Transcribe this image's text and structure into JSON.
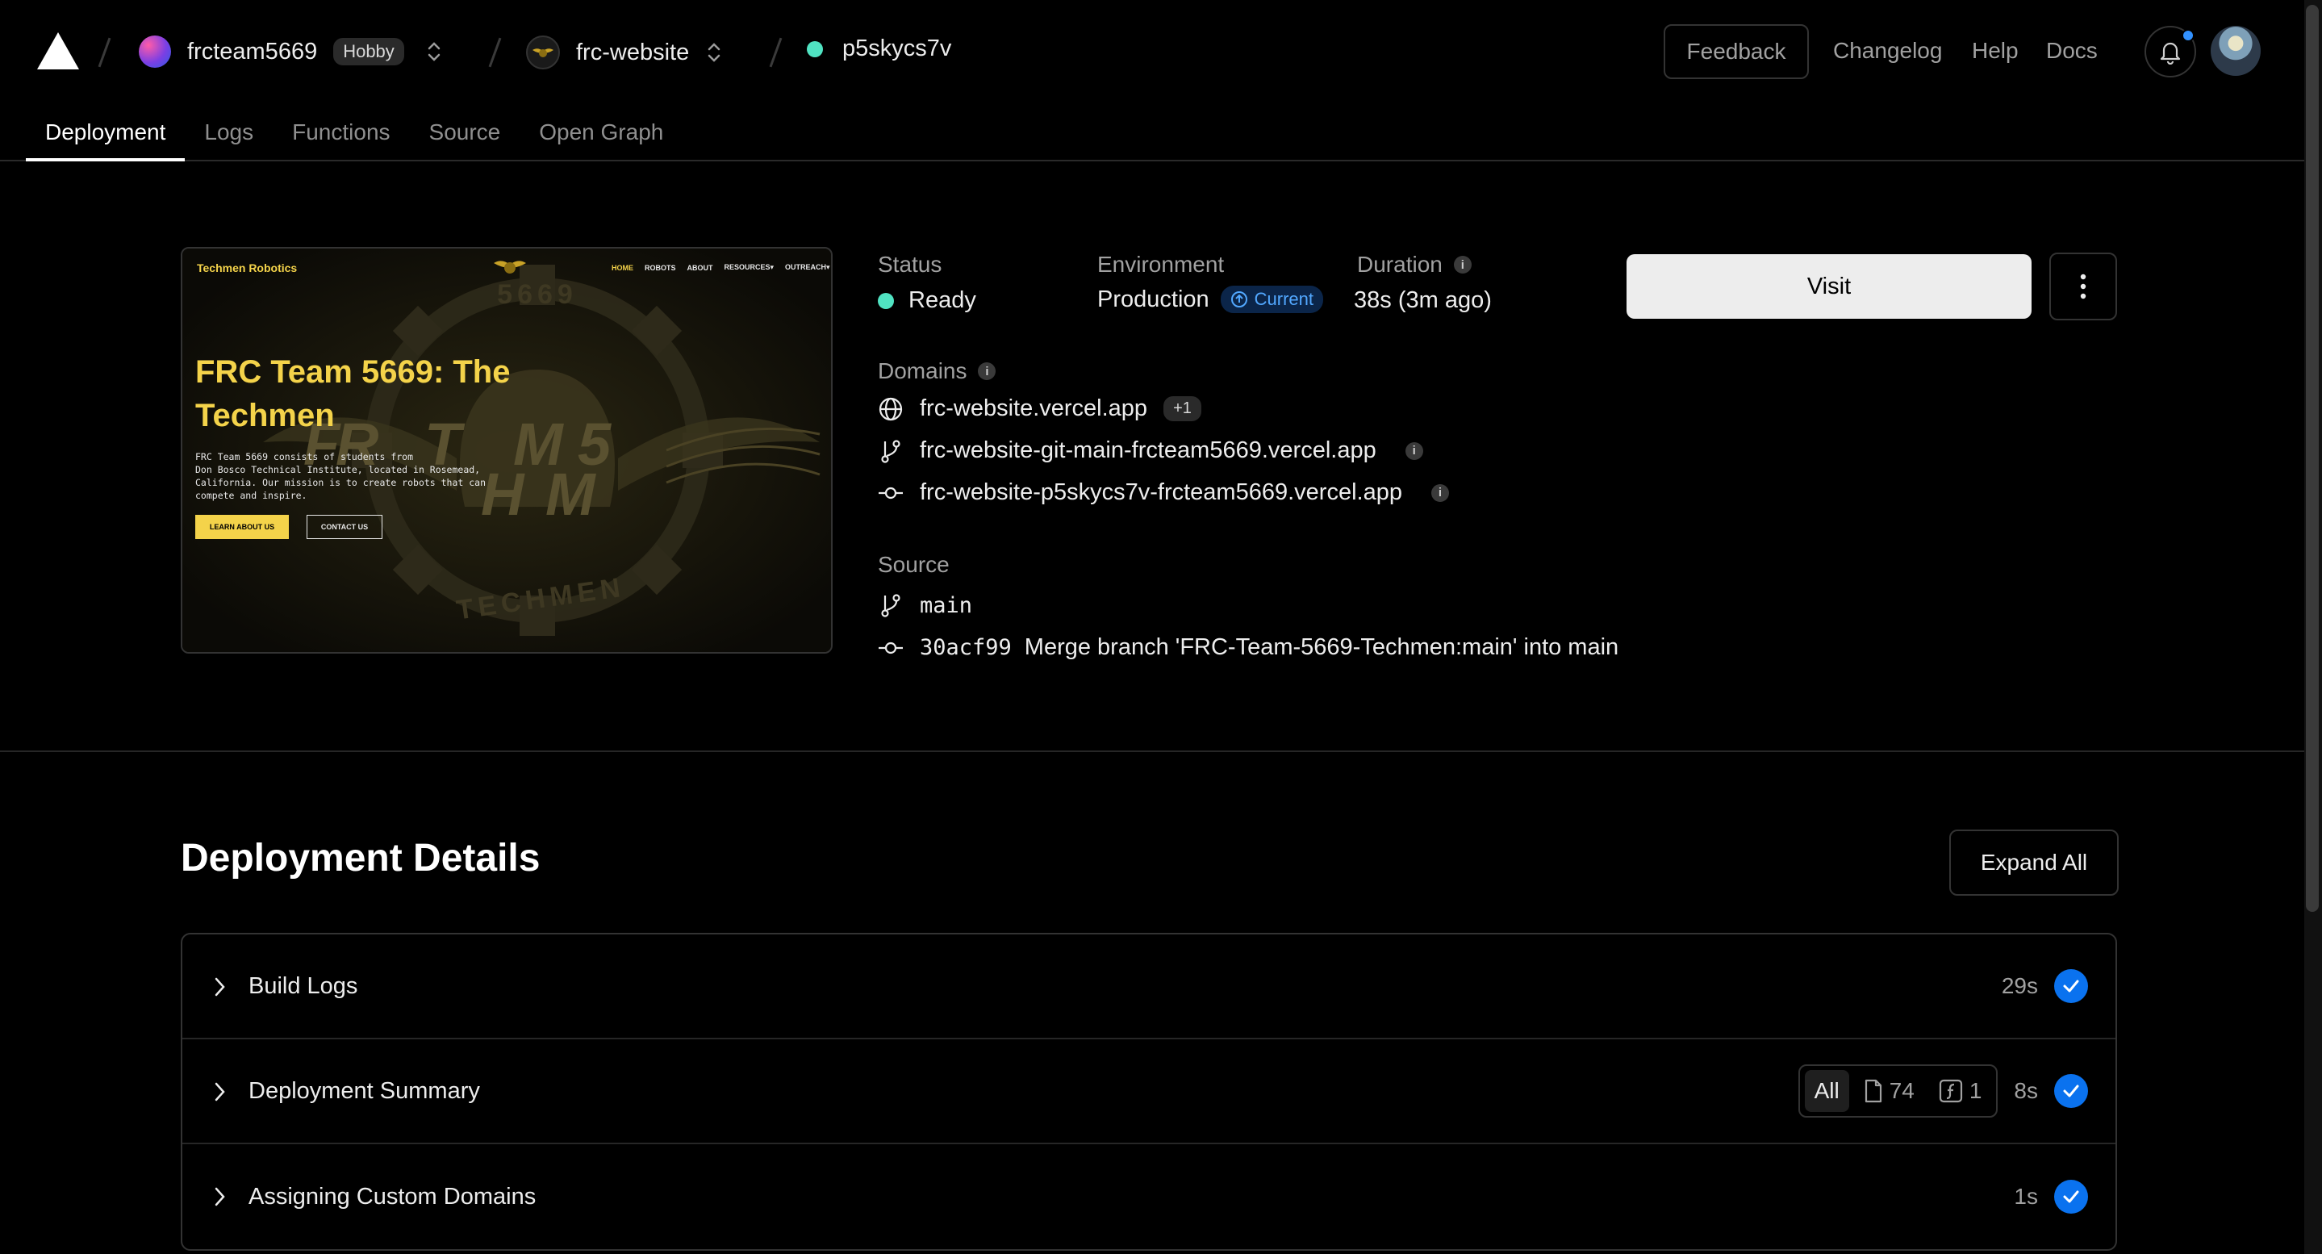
{
  "header": {
    "team": "frcteam5669",
    "plan_badge": "Hobby",
    "project": "frc-website",
    "deployment_id": "p5skycs7v",
    "feedback": "Feedback",
    "nav": [
      "Changelog",
      "Help",
      "Docs"
    ]
  },
  "tabs": [
    "Deployment",
    "Logs",
    "Functions",
    "Source",
    "Open Graph"
  ],
  "preview": {
    "site_name": "Techmen Robotics",
    "nav": [
      "HOME",
      "ROBOTS",
      "ABOUT",
      "RESOURCES▾",
      "OUTREACH▾"
    ],
    "heading_line1": "FRC Team 5669: The",
    "heading_line2": "Techmen",
    "body": [
      "FRC Team 5669 consists of students from",
      "Don Bosco Technical Institute, located in Rosemead,",
      "California. Our mission is to create robots that can",
      "compete and inspire."
    ],
    "btn_primary": "LEARN ABOUT US",
    "btn_secondary": "CONTACT US",
    "emblem_text_top": "5669",
    "emblem_text_bottom": "TECHMEN",
    "emblem_letters": [
      "F",
      "R",
      "T",
      "M",
      "5",
      "H",
      "M"
    ]
  },
  "status": {
    "status_label": "Status",
    "status_value": "Ready",
    "env_label": "Environment",
    "env_value": "Production",
    "env_badge": "Current",
    "duration_label": "Duration",
    "duration_value": "38s (3m ago)"
  },
  "domains": {
    "label": "Domains",
    "items": [
      {
        "icon": "globe-icon",
        "text": "frc-website.vercel.app",
        "extra": "+1"
      },
      {
        "icon": "git-branch-icon",
        "text": "frc-website-git-main-frcteam5669.vercel.app"
      },
      {
        "icon": "git-commit-icon",
        "text": "frc-website-p5skycs7v-frcteam5669.vercel.app"
      }
    ]
  },
  "source": {
    "label": "Source",
    "branch": "main",
    "commit_sha": "30acf99",
    "commit_msg": "Merge branch 'FRC-Team-5669-Techmen:main' into main"
  },
  "actions": {
    "visit": "Visit"
  },
  "details": {
    "title": "Deployment Details",
    "expand_all": "Expand All",
    "rows": [
      {
        "title": "Build Logs",
        "time": "29s"
      },
      {
        "title": "Deployment Summary",
        "time": "8s",
        "filter_all": "All",
        "files": "74",
        "functions": "1"
      },
      {
        "title": "Assigning Custom Domains",
        "time": "1s"
      }
    ]
  },
  "colors": {
    "status_ready": "#50e3c2",
    "accent_blue": "#0a72ef",
    "preview_yellow": "#f4d34a"
  }
}
